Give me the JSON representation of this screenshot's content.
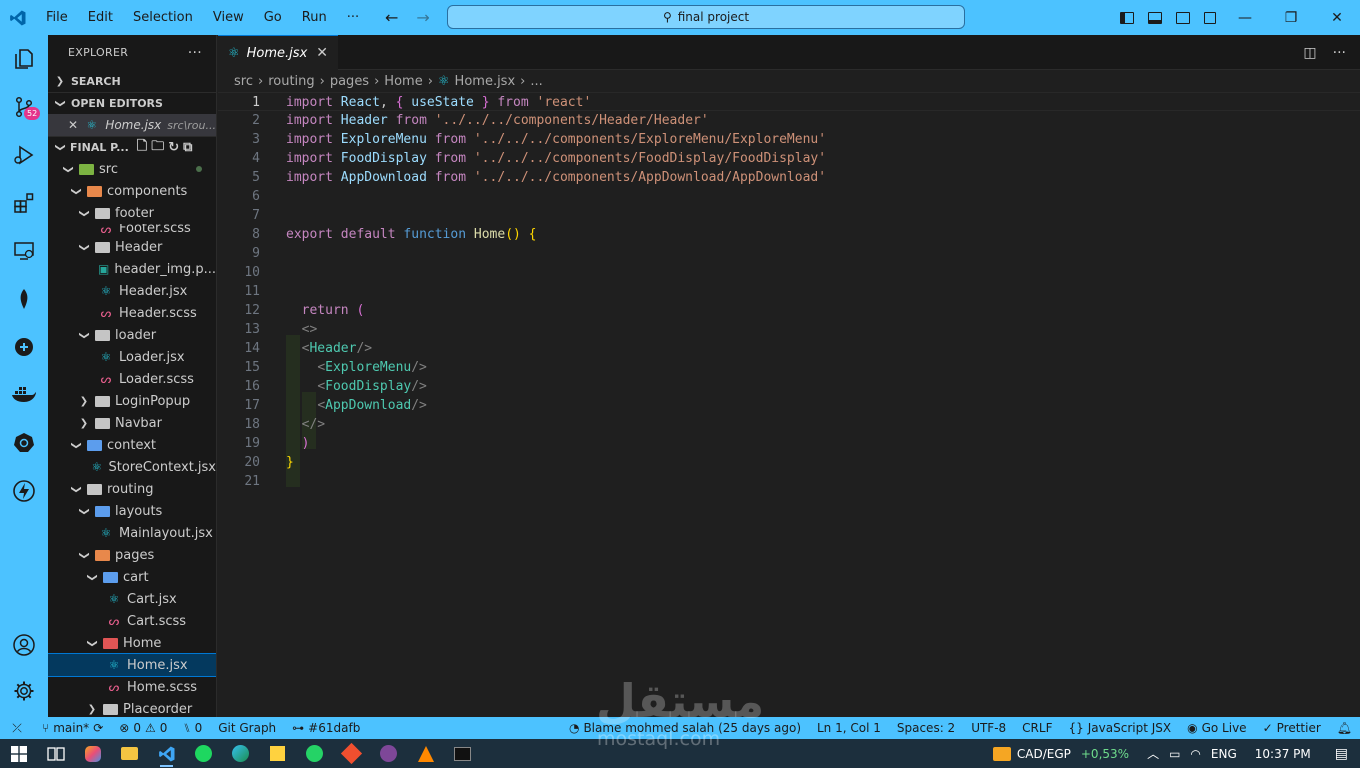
{
  "titlebar": {
    "menu": [
      "File",
      "Edit",
      "Selection",
      "View",
      "Go",
      "Run",
      "···"
    ],
    "search": "final project"
  },
  "activity_bar": {
    "scm_badge": "52",
    "icons": [
      "explorer-icon",
      "source-control-icon",
      "run-debug-icon",
      "extensions-icon",
      "remote-explorer-icon",
      "mongodb-icon",
      "gitlens-icon",
      "docker-icon",
      "kubernetes-icon",
      "thunder-client-icon",
      "account-icon",
      "manage-gear-icon"
    ]
  },
  "sidebar": {
    "title": "EXPLORER",
    "search_label": "SEARCH",
    "open_editors_label": "OPEN EDITORS",
    "open_editor": {
      "name": "Home.jsx",
      "path": "src\\rou..."
    },
    "project_label": "FINAL P...",
    "tree": [
      {
        "label": "src",
        "depth": 0,
        "type": "folder-open",
        "color": "green",
        "dot": true
      },
      {
        "label": "components",
        "depth": 1,
        "type": "folder-open",
        "color": "orange"
      },
      {
        "label": "footer",
        "depth": 2,
        "type": "folder-open",
        "color": "grey"
      },
      {
        "label": "Footer.scss",
        "depth": 3,
        "type": "scss",
        "partial": true
      },
      {
        "label": "Header",
        "depth": 2,
        "type": "folder-open",
        "color": "grey"
      },
      {
        "label": "header_img.p...",
        "depth": 3,
        "type": "image"
      },
      {
        "label": "Header.jsx",
        "depth": 3,
        "type": "react"
      },
      {
        "label": "Header.scss",
        "depth": 3,
        "type": "scss"
      },
      {
        "label": "loader",
        "depth": 2,
        "type": "folder-open",
        "color": "grey"
      },
      {
        "label": "Loader.jsx",
        "depth": 3,
        "type": "react"
      },
      {
        "label": "Loader.scss",
        "depth": 3,
        "type": "scss"
      },
      {
        "label": "LoginPopup",
        "depth": 2,
        "type": "folder-closed",
        "color": "grey"
      },
      {
        "label": "Navbar",
        "depth": 2,
        "type": "folder-closed",
        "color": "grey"
      },
      {
        "label": "context",
        "depth": 1,
        "type": "folder-open",
        "color": "blue"
      },
      {
        "label": "StoreContext.jsx",
        "depth": 2,
        "type": "react"
      },
      {
        "label": "routing",
        "depth": 1,
        "type": "folder-open",
        "color": "grey"
      },
      {
        "label": "layouts",
        "depth": 2,
        "type": "folder-open",
        "color": "blue"
      },
      {
        "label": "Mainlayout.jsx",
        "depth": 3,
        "type": "react"
      },
      {
        "label": "pages",
        "depth": 2,
        "type": "folder-open",
        "color": "orange"
      },
      {
        "label": "cart",
        "depth": 3,
        "type": "folder-open",
        "color": "blue"
      },
      {
        "label": "Cart.jsx",
        "depth": 4,
        "type": "react"
      },
      {
        "label": "Cart.scss",
        "depth": 4,
        "type": "scss"
      },
      {
        "label": "Home",
        "depth": 3,
        "type": "folder-open",
        "color": "red"
      },
      {
        "label": "Home.jsx",
        "depth": 4,
        "type": "react",
        "selected": true
      },
      {
        "label": "Home.scss",
        "depth": 4,
        "type": "scss"
      },
      {
        "label": "Placeorder",
        "depth": 3,
        "type": "folder-closed",
        "color": "grey"
      }
    ]
  },
  "editor": {
    "tab": "Home.jsx",
    "breadcrumb": [
      "src",
      "routing",
      "pages",
      "Home",
      "Home.jsx",
      "..."
    ],
    "active_line": 1,
    "lines": [
      [
        [
          "kw",
          "import"
        ],
        [
          "t",
          " "
        ],
        [
          "id",
          "React"
        ],
        [
          "t",
          ", "
        ],
        [
          "br2",
          "{"
        ],
        [
          "t",
          " "
        ],
        [
          "id",
          "useState"
        ],
        [
          "t",
          " "
        ],
        [
          "br2",
          "}"
        ],
        [
          "t",
          " "
        ],
        [
          "kw",
          "from"
        ],
        [
          "t",
          " "
        ],
        [
          "str",
          "'react'"
        ]
      ],
      [
        [
          "kw",
          "import"
        ],
        [
          "t",
          " "
        ],
        [
          "id",
          "Header"
        ],
        [
          "t",
          " "
        ],
        [
          "kw",
          "from"
        ],
        [
          "t",
          " "
        ],
        [
          "str",
          "'../../../components/Header/Header'"
        ]
      ],
      [
        [
          "kw",
          "import"
        ],
        [
          "t",
          " "
        ],
        [
          "id",
          "ExploreMenu"
        ],
        [
          "t",
          " "
        ],
        [
          "kw",
          "from"
        ],
        [
          "t",
          " "
        ],
        [
          "str",
          "'../../../components/ExploreMenu/ExploreMenu'"
        ]
      ],
      [
        [
          "kw",
          "import"
        ],
        [
          "t",
          " "
        ],
        [
          "id",
          "FoodDisplay"
        ],
        [
          "t",
          " "
        ],
        [
          "kw",
          "from"
        ],
        [
          "t",
          " "
        ],
        [
          "str",
          "'../../../components/FoodDisplay/FoodDisplay'"
        ]
      ],
      [
        [
          "kw",
          "import"
        ],
        [
          "t",
          " "
        ],
        [
          "id",
          "AppDownload"
        ],
        [
          "t",
          " "
        ],
        [
          "kw",
          "from"
        ],
        [
          "t",
          " "
        ],
        [
          "str",
          "'../../../components/AppDownload/AppDownload'"
        ]
      ],
      [],
      [],
      [
        [
          "kw",
          "export"
        ],
        [
          "t",
          " "
        ],
        [
          "kw",
          "default"
        ],
        [
          "t",
          " "
        ],
        [
          "bl",
          "function"
        ],
        [
          "t",
          " "
        ],
        [
          "fn",
          "Home"
        ],
        [
          "br1",
          "()"
        ],
        [
          "t",
          " "
        ],
        [
          "br1",
          "{"
        ]
      ],
      [],
      [],
      [],
      [
        [
          "t",
          "  "
        ],
        [
          "kw",
          "return"
        ],
        [
          "t",
          " "
        ],
        [
          "br2",
          "("
        ]
      ],
      [
        [
          "t",
          "  "
        ],
        [
          "pun",
          "<>"
        ]
      ],
      [
        [
          "t",
          "  "
        ],
        [
          "pun",
          "<"
        ],
        [
          "tag",
          "Header"
        ],
        [
          "pun",
          "/>"
        ]
      ],
      [
        [
          "t",
          "    "
        ],
        [
          "pun",
          "<"
        ],
        [
          "tag",
          "ExploreMenu"
        ],
        [
          "pun",
          "/>"
        ]
      ],
      [
        [
          "t",
          "    "
        ],
        [
          "pun",
          "<"
        ],
        [
          "tag",
          "FoodDisplay"
        ],
        [
          "pun",
          "/>"
        ]
      ],
      [
        [
          "t",
          "    "
        ],
        [
          "pun",
          "<"
        ],
        [
          "tag",
          "AppDownload"
        ],
        [
          "pun",
          "/>"
        ]
      ],
      [
        [
          "t",
          "  "
        ],
        [
          "pun",
          "</>"
        ]
      ],
      [
        [
          "t",
          "  "
        ],
        [
          "br2",
          ")"
        ]
      ],
      [
        [
          "br1",
          "}"
        ]
      ],
      []
    ]
  },
  "statusbar": {
    "branch": "main*",
    "problems": "0",
    "warnings": "0",
    "ports": "0",
    "git_graph": "Git Graph",
    "commit": "#61dafb",
    "blame": "Blame mohmed salah (25 days ago)",
    "position": "Ln 1, Col 1",
    "spaces": "Spaces: 2",
    "encoding": "UTF-8",
    "eol": "CRLF",
    "language": "JavaScript JSX",
    "golive": "Go Live",
    "prettier": "Prettier"
  },
  "taskbar": {
    "ticker": "CAD/EGP",
    "change": "+0,53%",
    "lang": "ENG",
    "time": "10:37 PM"
  },
  "watermark": {
    "arabic": "مستقل",
    "latin": "mostaql.com"
  }
}
